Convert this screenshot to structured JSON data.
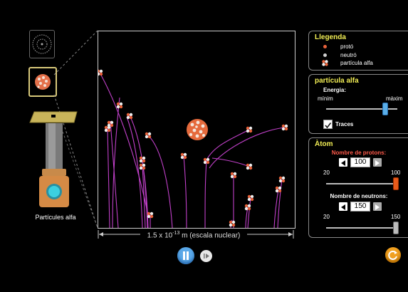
{
  "legend": {
    "title": "Llegenda",
    "items": [
      {
        "label": "protó",
        "icon": "proton-dot-icon",
        "color": "#e8623a"
      },
      {
        "label": "neutró",
        "icon": "neutron-dot-icon",
        "color": "#cfcfcf"
      },
      {
        "label": "partícula alfa",
        "icon": "alpha-particle-icon",
        "color": "#e8623a"
      }
    ]
  },
  "alpha_panel": {
    "title": "partícula alfa",
    "energy_label": "Energia:",
    "min_label": "mínim",
    "max_label": "màxim",
    "energy_level": 0.82,
    "traces_label": "Traces",
    "traces_checked": true
  },
  "atom_panel": {
    "title": "Àtom",
    "protons_label": "Nombre de protons:",
    "protons_value": "100",
    "protons_min": "20",
    "protons_max": "100",
    "neutrons_label": "Nombre de neutrons:",
    "neutrons_value": "150",
    "neutrons_min": "20",
    "neutrons_max": "150"
  },
  "source_label": "Partícules alfa",
  "scale_label": {
    "prefix": "1.5 x 10",
    "exponent": "-13",
    "suffix": " m (escala nuclear)"
  },
  "colors": {
    "panel_title": "#f2ee55",
    "protons_label": "#ff5a4a",
    "trace": "#c040c8",
    "play_button": "#5aa8e8",
    "reset_button": "#f0a020",
    "selected_border": "#d8c87a"
  }
}
